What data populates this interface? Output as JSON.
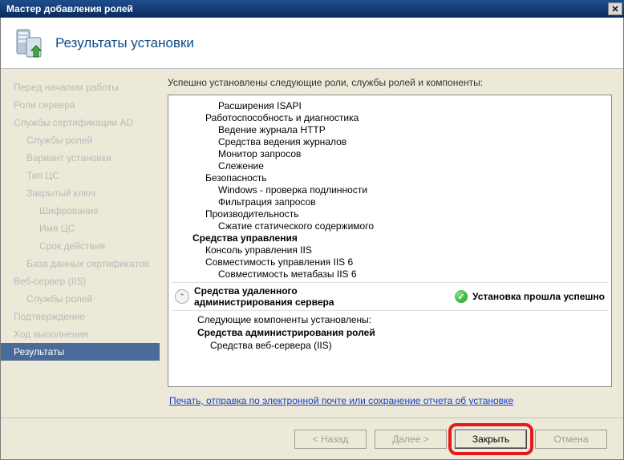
{
  "window": {
    "title": "Мастер добавления ролей"
  },
  "header": {
    "title": "Результаты установки"
  },
  "sidebar": {
    "items": [
      {
        "label": "Перед началом работы",
        "indent": 0
      },
      {
        "label": "Роли сервера",
        "indent": 0
      },
      {
        "label": "Службы сертификации AD",
        "indent": 0
      },
      {
        "label": "Службы ролей",
        "indent": 1
      },
      {
        "label": "Вариант установки",
        "indent": 1
      },
      {
        "label": "Тип ЦС",
        "indent": 1
      },
      {
        "label": "Закрытый ключ",
        "indent": 1
      },
      {
        "label": "Шифрование",
        "indent": 2
      },
      {
        "label": "Имя ЦС",
        "indent": 2
      },
      {
        "label": "Срок действия",
        "indent": 2
      },
      {
        "label": "База данных сертификатов",
        "indent": 1
      },
      {
        "label": "Веб-сервер (IIS)",
        "indent": 0
      },
      {
        "label": "Службы ролей",
        "indent": 1
      },
      {
        "label": "Подтверждение",
        "indent": 0
      },
      {
        "label": "Ход выполнения",
        "indent": 0
      },
      {
        "label": "Результаты",
        "indent": 0,
        "active": true
      }
    ]
  },
  "content": {
    "intro": "Успешно установлены следующие роли, службы ролей и компоненты:",
    "tree": [
      {
        "label": "Расширения ISAPI",
        "indent": 3,
        "bold": false
      },
      {
        "label": "Работоспособность и диагностика",
        "indent": 2,
        "bold": false
      },
      {
        "label": "Ведение журнала HTTP",
        "indent": 3,
        "bold": false
      },
      {
        "label": "Средства ведения журналов",
        "indent": 3,
        "bold": false
      },
      {
        "label": "Монитор запросов",
        "indent": 3,
        "bold": false
      },
      {
        "label": "Слежение",
        "indent": 3,
        "bold": false
      },
      {
        "label": "Безопасность",
        "indent": 2,
        "bold": false
      },
      {
        "label": "Windows - проверка подлинности",
        "indent": 3,
        "bold": false
      },
      {
        "label": "Фильтрация запросов",
        "indent": 3,
        "bold": false
      },
      {
        "label": "Производительность",
        "indent": 2,
        "bold": false
      },
      {
        "label": "Сжатие статического содержимого",
        "indent": 3,
        "bold": false
      },
      {
        "label": "Средства управления",
        "indent": 1,
        "bold": true
      },
      {
        "label": "Консоль управления IIS",
        "indent": 2,
        "bold": false
      },
      {
        "label": "Совместимость управления IIS 6",
        "indent": 2,
        "bold": false
      },
      {
        "label": "Совместимость метабазы IIS 6",
        "indent": 3,
        "bold": false
      }
    ],
    "section": {
      "title": "Средства удаленного администрирования сервера",
      "status": "Установка прошла успешно",
      "sub_intro": "Следующие компоненты установлены:",
      "sub_bold": "Средства администрирования ролей",
      "sub_item": "Средства веб-сервера (IIS)"
    },
    "report_link": "Печать, отправка по электронной почте или сохранение отчета об установке"
  },
  "buttons": {
    "back": "< Назад",
    "next": "Далее >",
    "close": "Закрыть",
    "cancel": "Отмена"
  }
}
